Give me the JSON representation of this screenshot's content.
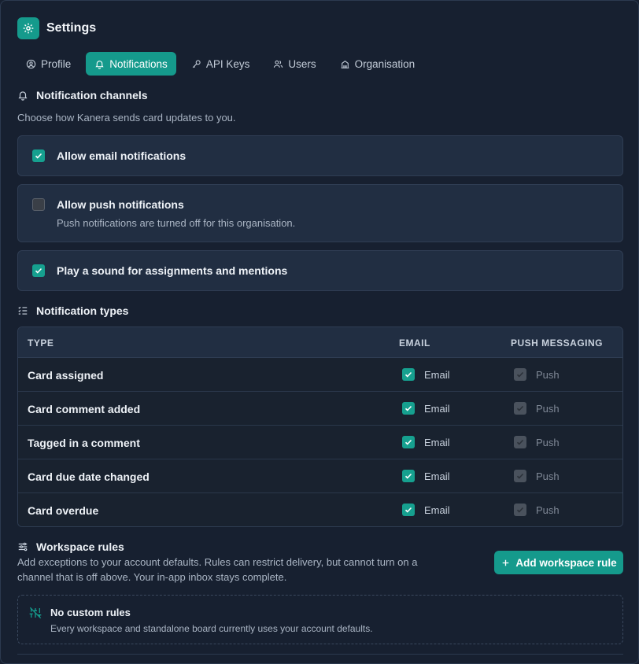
{
  "header": {
    "title": "Settings",
    "icon": "gear-icon"
  },
  "tabs": [
    {
      "label": "Profile",
      "icon": "user-circle-icon",
      "active": false
    },
    {
      "label": "Notifications",
      "icon": "bell-icon",
      "active": true
    },
    {
      "label": "API Keys",
      "icon": "key-icon",
      "active": false
    },
    {
      "label": "Users",
      "icon": "users-icon",
      "active": false
    },
    {
      "label": "Organisation",
      "icon": "building-icon",
      "active": false
    }
  ],
  "channels": {
    "heading": "Notification channels",
    "description": "Choose how Kanera sends card updates to you.",
    "email": {
      "label": "Allow email notifications",
      "checked": true
    },
    "push": {
      "label": "Allow push notifications",
      "sub": "Push notifications are turned off for this organisation.",
      "checked": false
    },
    "sound": {
      "label": "Play a sound for assignments and mentions",
      "checked": true
    }
  },
  "types": {
    "heading": "Notification types",
    "columns": {
      "type": "TYPE",
      "email": "EMAIL",
      "push": "PUSH MESSAGING"
    },
    "rows": [
      {
        "name": "Card assigned",
        "email_label": "Email",
        "push_label": "Push"
      },
      {
        "name": "Card comment added",
        "email_label": "Email",
        "push_label": "Push"
      },
      {
        "name": "Tagged in a comment",
        "email_label": "Email",
        "push_label": "Push"
      },
      {
        "name": "Card due date changed",
        "email_label": "Email",
        "push_label": "Push"
      },
      {
        "name": "Card overdue",
        "email_label": "Email",
        "push_label": "Push"
      }
    ]
  },
  "rules": {
    "heading": "Workspace rules",
    "description_line1": "Add exceptions to your account defaults. Rules can restrict delivery, but cannot turn on a",
    "description_line2": "channel that is off above. Your in-app inbox stays complete.",
    "add_button": "Add workspace rule",
    "empty_title": "No custom rules",
    "empty_sub": "Every workspace and standalone board currently uses your account defaults."
  },
  "colors": {
    "accent": "#159a8c",
    "background": "#172030",
    "card": "#212e42"
  }
}
